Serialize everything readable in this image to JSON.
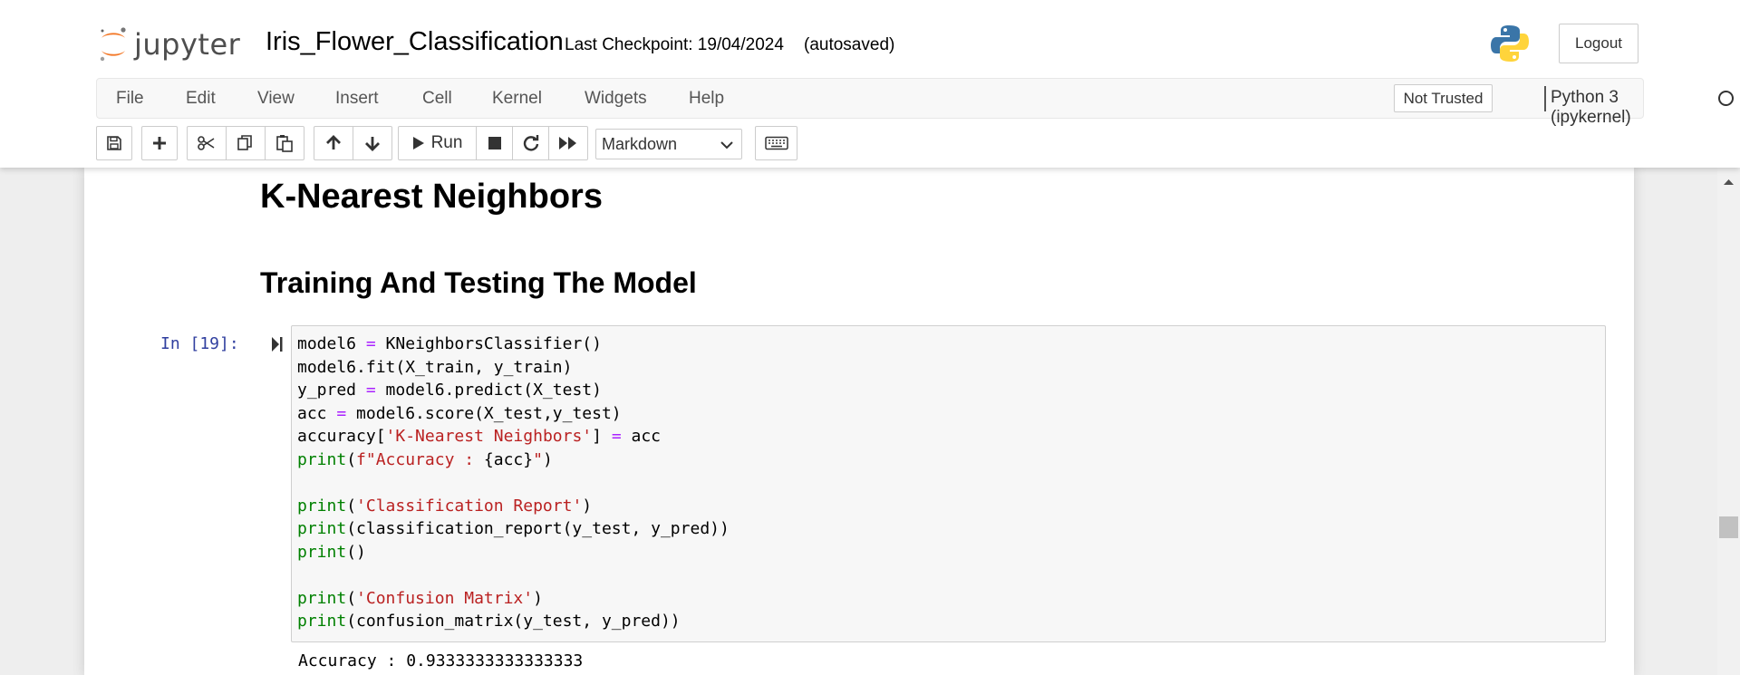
{
  "header": {
    "logo_text": "jupyter",
    "notebook_title": "Iris_Flower_Classification",
    "checkpoint": "Last Checkpoint: 19/04/2024",
    "autosaved": "(autosaved)",
    "logout_label": "Logout"
  },
  "menubar": {
    "items": [
      "File",
      "Edit",
      "View",
      "Insert",
      "Cell",
      "Kernel",
      "Widgets",
      "Help"
    ],
    "trust_label": "Not Trusted",
    "kernel_name": "Python 3 (ipykernel)"
  },
  "toolbar": {
    "run_label": "Run",
    "cell_type_value": "Markdown",
    "icons": [
      "save-icon",
      "plus-icon",
      "cut-icon",
      "copy-icon",
      "paste-icon",
      "arrow-up-icon",
      "arrow-down-icon",
      "play-icon",
      "stop-icon",
      "restart-icon",
      "fast-forward-icon",
      "keyboard-icon"
    ]
  },
  "notebook": {
    "heading1": "K-Nearest Neighbors",
    "heading2": "Training And Testing The Model",
    "prompt": "In [19]:",
    "code_lines": [
      [
        [
          "model6 ",
          "t"
        ],
        [
          "=",
          "op"
        ],
        [
          " KNeighborsClassifier()",
          "t"
        ]
      ],
      [
        [
          "model6.fit(X_train, y_train)",
          "t"
        ]
      ],
      [
        [
          "y_pred ",
          "t"
        ],
        [
          "=",
          "op"
        ],
        [
          " model6.predict(X_test)",
          "t"
        ]
      ],
      [
        [
          "acc ",
          "t"
        ],
        [
          "=",
          "op"
        ],
        [
          " model6.score(X_test,y_test)",
          "t"
        ]
      ],
      [
        [
          "accuracy[",
          "t"
        ],
        [
          "'K-Nearest Neighbors'",
          "str"
        ],
        [
          "] ",
          "t"
        ],
        [
          "=",
          "op"
        ],
        [
          " acc",
          "t"
        ]
      ],
      [
        [
          "print",
          "kw"
        ],
        [
          "(",
          "t"
        ],
        [
          "f\"Accuracy : ",
          "str"
        ],
        [
          "{acc}",
          "t"
        ],
        [
          "\"",
          "str"
        ],
        [
          ")",
          "t"
        ]
      ],
      [],
      [
        [
          "print",
          "kw"
        ],
        [
          "(",
          "t"
        ],
        [
          "'Classification Report'",
          "str"
        ],
        [
          ")",
          "t"
        ]
      ],
      [
        [
          "print",
          "kw"
        ],
        [
          "(classification_report(y_test, y_pred))",
          "t"
        ]
      ],
      [
        [
          "print",
          "kw"
        ],
        [
          "()",
          "t"
        ]
      ],
      [],
      [
        [
          "print",
          "kw"
        ],
        [
          "(",
          "t"
        ],
        [
          "'Confusion Matrix'",
          "str"
        ],
        [
          ")",
          "t"
        ]
      ],
      [
        [
          "print",
          "kw"
        ],
        [
          "(confusion_matrix(y_test, y_pred))",
          "t"
        ]
      ]
    ],
    "output_text": "Accuracy : 0.9333333333333333"
  },
  "colors": {
    "keyword": "#008000",
    "operator": "#aa22ff",
    "string": "#ba2121",
    "prompt": "#303f9f"
  }
}
